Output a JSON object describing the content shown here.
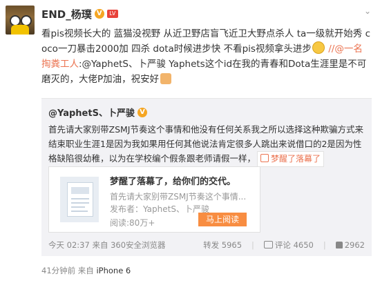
{
  "post": {
    "username": "END_杨璞",
    "v_badge": "V",
    "level_badge": "LV",
    "text_plain_1": "看pis视频长大的 蓝猫没视野 从近卫野店盲飞近卫大野点杀人 ta一级就开始秀 coco一刀暴击2000加 四杀 dota时候进步快 不看pis视频拿头进步",
    "text_link": "//@一名掏粪工人",
    "text_plain_2": ":@YaphetS、卜严骏 Yaphets这个id在我的青春和Dota生涯里是不可磨灭的，大佬P加油，祝安好",
    "time": "41分钟前",
    "source_prefix": "来自",
    "source": "iPhone 6"
  },
  "repost": {
    "username": "@YaphetS、卜严骏",
    "v_badge": "V",
    "text": "首先请大家别带ZSMJ节奏这个事情和他没有任何关系我之所以选择这种欺骗方式来结束职业生涯1是因为我如果用任何其他说法肯定很多人跳出来说借口的2是因为性格缺陷很幼稚，以为在学校编个假条跟老师请假一样，",
    "link_chip": "梦醒了落幕了",
    "card": {
      "title": "梦醒了落幕了，给你们的交代。",
      "desc": "首先请大家别带ZSMJ节奏这个事情...",
      "author": "发布者：YaphetS、卜严骏",
      "reads": "阅读:80万+",
      "read_button": "马上阅读"
    },
    "meta": "今天 02:37 来自 360安全浏览器",
    "repost_label": "转发 5965",
    "comment_label": "评论 4650",
    "like_count": "2962"
  },
  "colors": {
    "link": "#eb7350",
    "read_button": "#f88d41",
    "repost_bg": "#f2f2f5"
  }
}
